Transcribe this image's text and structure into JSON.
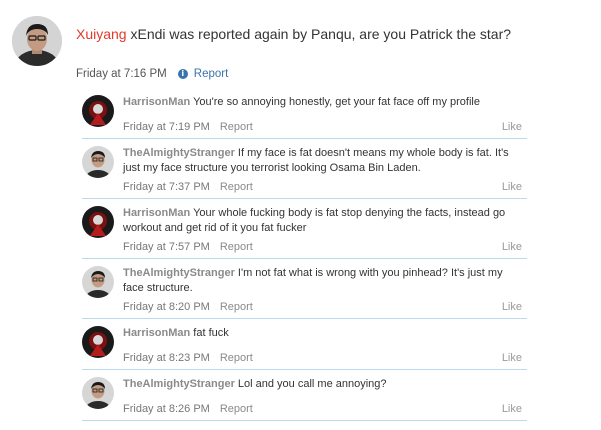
{
  "post": {
    "author": "Xuiyang",
    "text": " xEndi was reported again by Panqu, are you Patrick the star?",
    "time": "Friday at 7:16 PM",
    "report_label": "Report",
    "author_color": "#e03b2b"
  },
  "comments": [
    {
      "author": "HarrisonMan",
      "text": " You're so annoying honestly, get your fat face off my profile",
      "time": "Friday at 7:19 PM",
      "report": "Report",
      "like": "Like",
      "avatar": "dark-avatar"
    },
    {
      "author": "TheAlmightyStranger",
      "text": " If my face is fat doesn't means my whole body is fat. It's just my face structure you terrorist looking Osama Bin Laden.",
      "time": "Friday at 7:37 PM",
      "report": "Report",
      "like": "Like",
      "avatar": "photo-avatar"
    },
    {
      "author": "HarrisonMan",
      "text": " Your whole fucking body is fat stop denying the facts, instead go workout and get rid of it you fat fucker",
      "time": "Friday at 7:57 PM",
      "report": "Report",
      "like": "Like",
      "avatar": "dark-avatar"
    },
    {
      "author": "TheAlmightyStranger",
      "text": " I'm not fat what is wrong with you pinhead? It's just my face structure.",
      "time": "Friday at 8:20 PM",
      "report": "Report",
      "like": "Like",
      "avatar": "photo-avatar"
    },
    {
      "author": "HarrisonMan",
      "text": " fat fuck",
      "time": "Friday at 8:23 PM",
      "report": "Report",
      "like": "Like",
      "avatar": "dark-avatar"
    },
    {
      "author": "TheAlmightyStranger",
      "text": " Lol and you call me annoying?",
      "time": "Friday at 8:26 PM",
      "report": "Report",
      "like": "Like",
      "avatar": "photo-avatar"
    }
  ],
  "colors": {
    "link": "#3a74ad",
    "divider": "#b9dbeb",
    "comment_author": "#8a8a8a"
  }
}
